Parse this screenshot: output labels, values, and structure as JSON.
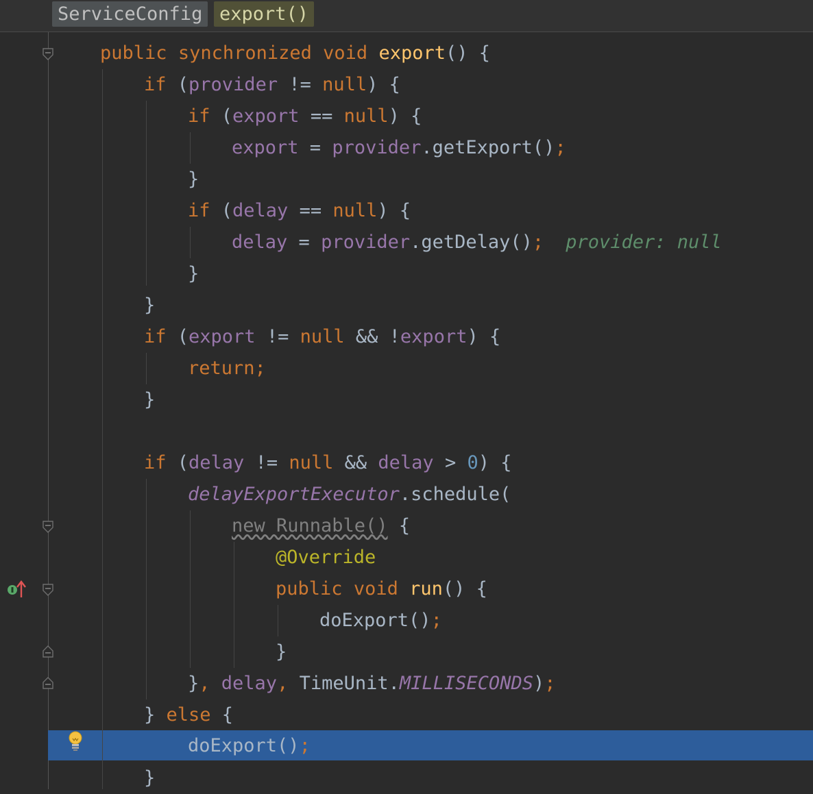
{
  "breadcrumb": {
    "class_name": "ServiceConfig",
    "method_name": "export()"
  },
  "colors": {
    "background": "#2b2b2b",
    "keyword": "#cc7832",
    "method_decl": "#ffc66d",
    "field": "#9876aa",
    "number": "#6897bb",
    "annotation": "#bbb529",
    "inline_hint": "#5e8e6b",
    "selected_line": "#2d5d9b"
  },
  "icons": [
    "fold-icon",
    "implements-up-icon",
    "lightbulb-icon"
  ],
  "editor": {
    "current_line": 23,
    "inline_hint": "provider: null",
    "lines": [
      {
        "t1": "public",
        "t2": " ",
        "t3": "synchronized",
        "t4": " ",
        "t5": "void",
        "t6": " ",
        "t7": "export",
        "t8": "() {"
      },
      {
        "t1": "if",
        "t2": " (",
        "t3": "provider",
        "t4": " != ",
        "t5": "null",
        "t6": ") {"
      },
      {
        "t1": "if",
        "t2": " (",
        "t3": "export",
        "t4": " == ",
        "t5": "null",
        "t6": ") {"
      },
      {
        "t1": "export",
        "t2": " = ",
        "t3": "provider",
        "t4": ".getExport()",
        "t5": ";"
      },
      {
        "t1": "}"
      },
      {
        "t1": "if",
        "t2": " (",
        "t3": "delay",
        "t4": " == ",
        "t5": "null",
        "t6": ") {"
      },
      {
        "t1": "delay",
        "t2": " = ",
        "t3": "provider",
        "t4": ".getDelay()",
        "t5": ";"
      },
      {
        "t1": "}"
      },
      {
        "t1": "}"
      },
      {
        "t1": "if",
        "t2": " (",
        "t3": "export",
        "t4": " != ",
        "t5": "null",
        "t6": " && !",
        "t7": "export",
        "t8": ") {"
      },
      {
        "t1": "return",
        "t2": ";"
      },
      {
        "t1": "}"
      },
      {
        "t1": "if",
        "t2": " (",
        "t3": "delay",
        "t4": " != ",
        "t5": "null",
        "t6": " && ",
        "t7": "delay",
        "t8": " > ",
        "t9": "0",
        "t10": ") {"
      },
      {
        "t1": "delayExportExecutor",
        "t2": ".schedule("
      },
      {
        "t1": "new Runnable()",
        "t2": " {"
      },
      {
        "t1": "@Override"
      },
      {
        "t1": "public",
        "t2": " ",
        "t3": "void",
        "t4": " ",
        "t5": "run",
        "t6": "() {"
      },
      {
        "t1": "doExport()",
        "t2": ";"
      },
      {
        "t1": "}"
      },
      {
        "t1": "}",
        "t2": ", ",
        "t3": "delay",
        "t4": ", ",
        "t5": "TimeUnit.",
        "t6": "MILLISECONDS",
        "t7": ")",
        "t8": ";"
      },
      {
        "t1": "} ",
        "t2": "else",
        "t3": " {"
      },
      {
        "t1": "doExport()",
        "t2": ";"
      },
      {
        "t1": "}"
      }
    ]
  }
}
